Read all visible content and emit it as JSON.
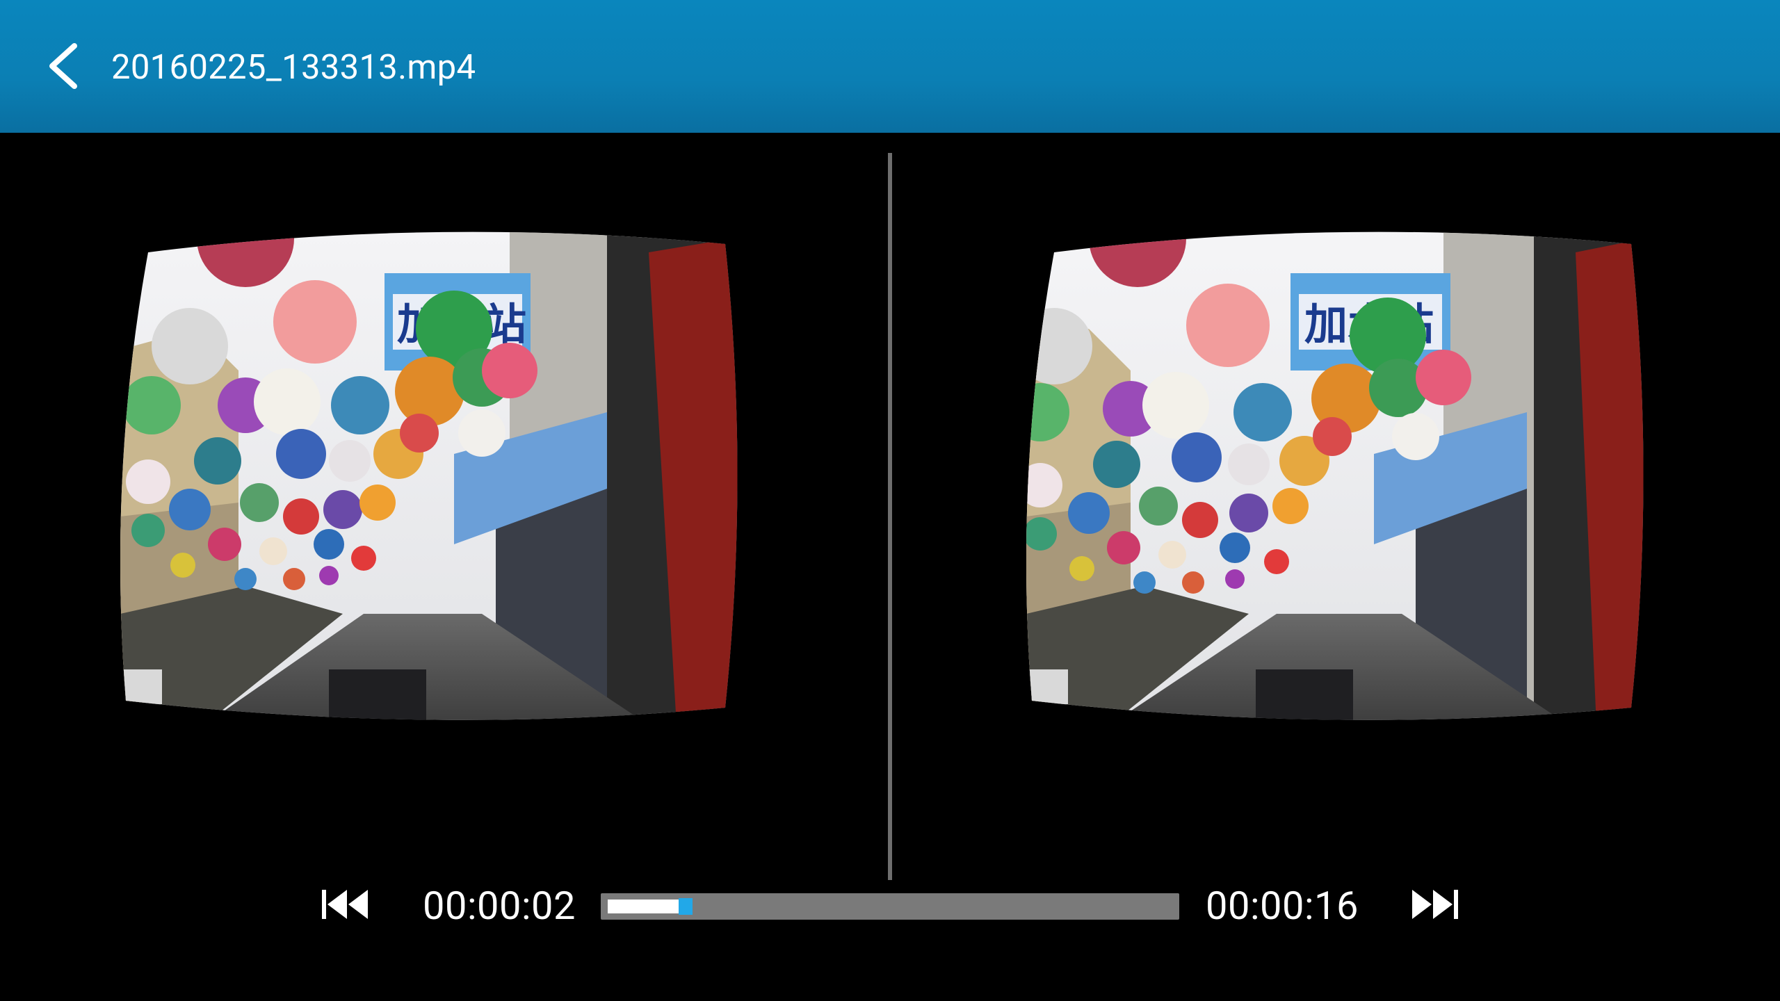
{
  "header": {
    "title": "20160225_133313.mp4",
    "back_icon": "arrow-back-icon",
    "background_color": "#0a86bd"
  },
  "player": {
    "mode": "vr-side-by-side",
    "current_time": "00:00:02",
    "total_time": "00:00:16",
    "progress_fraction": 0.13,
    "prev_icon": "skip-previous-icon",
    "next_icon": "skip-next-icon",
    "accent_color": "#22a8e8"
  }
}
